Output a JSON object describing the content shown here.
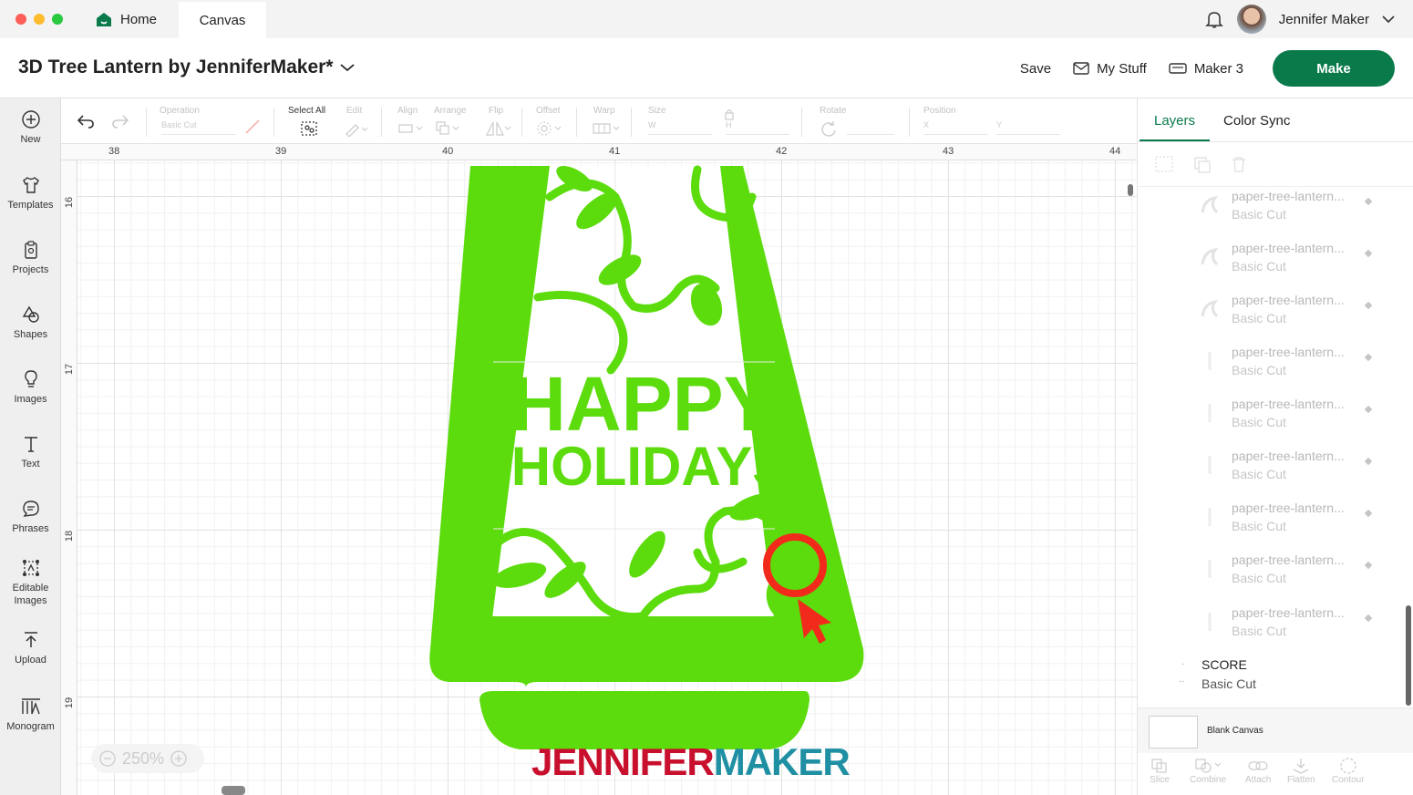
{
  "tabs": {
    "home": "Home",
    "canvas": "Canvas"
  },
  "user": {
    "name": "Jennifer Maker"
  },
  "project": {
    "title": "3D Tree Lantern by JenniferMaker*"
  },
  "header": {
    "save": "Save",
    "my_stuff": "My Stuff",
    "machine": "Maker 3",
    "make": "Make"
  },
  "left_toolbar": {
    "new": "New",
    "templates": "Templates",
    "projects": "Projects",
    "shapes": "Shapes",
    "images": "Images",
    "text": "Text",
    "phrases": "Phrases",
    "editable": "Editable",
    "editable2": "Images",
    "upload": "Upload",
    "monogram": "Monogram"
  },
  "edit_toolbar": {
    "operation": "Operation",
    "operation_value": "Basic Cut",
    "select_all": "Select All",
    "edit": "Edit",
    "align": "Align",
    "arrange": "Arrange",
    "flip": "Flip",
    "offset": "Offset",
    "warp": "Warp",
    "size": "Size",
    "size_w": "W",
    "size_h": "H",
    "rotate": "Rotate",
    "position": "Position",
    "pos_x": "X",
    "pos_y": "Y"
  },
  "ruler": {
    "top": [
      "38",
      "39",
      "40",
      "41",
      "42",
      "43",
      "44"
    ],
    "left": [
      "16",
      "17",
      "18",
      "19"
    ]
  },
  "canvas_art": {
    "line1": "HAPPY",
    "line2": "HOLIDAYS",
    "fill_color": "#5cdc0c"
  },
  "zoom": {
    "level": "250%"
  },
  "watermark": {
    "part1": "JENNIFER",
    "part2": "MAKER"
  },
  "right_panel": {
    "tab_layers": "Layers",
    "tab_colorsync": "Color Sync",
    "layers": [
      {
        "name": "paper-tree-lantern...",
        "op": "Basic Cut"
      },
      {
        "name": "paper-tree-lantern...",
        "op": "Basic Cut"
      },
      {
        "name": "paper-tree-lantern...",
        "op": "Basic Cut"
      },
      {
        "name": "paper-tree-lantern...",
        "op": "Basic Cut"
      },
      {
        "name": "paper-tree-lantern...",
        "op": "Basic Cut"
      },
      {
        "name": "paper-tree-lantern...",
        "op": "Basic Cut"
      },
      {
        "name": "paper-tree-lantern...",
        "op": "Basic Cut"
      },
      {
        "name": "paper-tree-lantern...",
        "op": "Basic Cut"
      },
      {
        "name": "paper-tree-lantern...",
        "op": "Basic Cut"
      }
    ],
    "score": {
      "name": "SCORE",
      "op": "Basic Cut"
    },
    "blank_canvas": "Blank Canvas",
    "bottom_tools": {
      "slice": "Slice",
      "combine": "Combine",
      "attach": "Attach",
      "flatten": "Flatten",
      "contour": "Contour"
    }
  },
  "colors": {
    "brand_green": "#0b7a4b",
    "accent_red": "#f22a1c"
  }
}
